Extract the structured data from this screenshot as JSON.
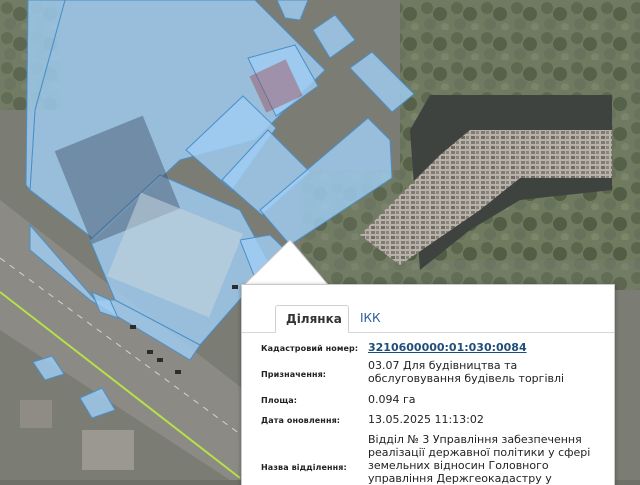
{
  "map": {
    "parcel_color": "#9fcdf2",
    "parcel_border": "#4a8fc9",
    "road_line_color": "#b6e04a"
  },
  "popup": {
    "tabs": [
      {
        "label": "Ділянка",
        "active": true
      },
      {
        "label": "ІКК",
        "active": false
      }
    ],
    "fields": {
      "cadastral_label": "Кадастровий номер:",
      "cadastral_value": "3210600000:01:030:0084",
      "purpose_label": "Призначення:",
      "purpose_value": "03.07 Для будівництва та обслуговування будівель торгівлі",
      "area_label": "Площа:",
      "area_value": "0.094 га",
      "updated_label": "Дата оновлення:",
      "updated_value": "13.05.2025 11:13:02",
      "department_label": "Назва відділення:",
      "department_value": "Відділ № 3 Управління забезпечення реалізації державної політики у сфері земельних відносин Головного управління Держгеокадастру у Київській області"
    }
  }
}
